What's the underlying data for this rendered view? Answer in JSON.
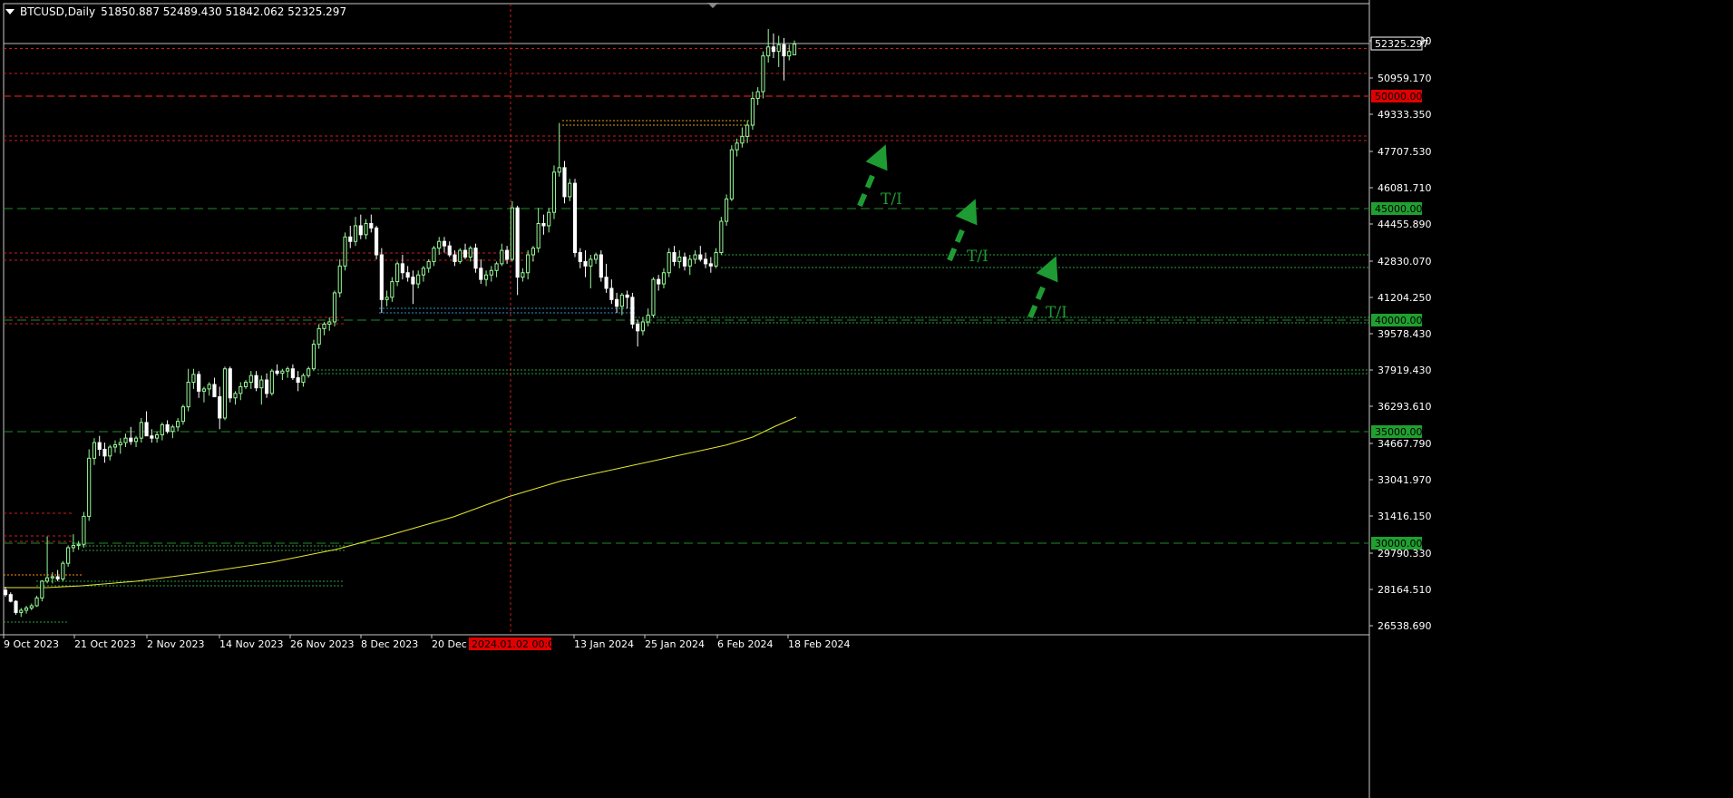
{
  "header": {
    "symbol": "BTCUSD,Daily",
    "ohlc": "51850.887 52489.430 51842.062 52325.297"
  },
  "colors": {
    "background": "#000000",
    "grid_border": "#c8c8c8",
    "candle_bull": "#98fb98",
    "candle_bear": "#ffffff",
    "red_line": "#c81e1e",
    "green_line": "#1e8c2d",
    "ma_line": "#e6e632",
    "arrow": "#1e9b32"
  },
  "price_axis": {
    "ticks": [
      "52584.090",
      "50959.170",
      "49333.350",
      "47707.530",
      "46081.710",
      "44455.890",
      "42830.070",
      "41204.250",
      "39578.430",
      "37919.430",
      "36293.610",
      "34667.790",
      "33041.970",
      "31416.150",
      "29790.330",
      "28164.510",
      "26538.690"
    ],
    "current_label": "52325.297",
    "badge_red": "50000.000",
    "badge_green_1": "45000.000",
    "badge_green_2": "40000.000",
    "badge_green_3": "35000.000",
    "badge_green_4": "30000.000"
  },
  "time_axis": {
    "ticks": [
      "9 Oct 2023",
      "21 Oct 2023",
      "2 Nov 2023",
      "14 Nov 2023",
      "26 Nov 2023",
      "8 Dec 2023",
      "20 Dec 2",
      "13 Jan 2024",
      "25 Jan 2024",
      "6 Feb 2024",
      "18 Feb 2024"
    ],
    "crosshair_label": "2024.01.02 00:00"
  },
  "annotations": {
    "ti_1": "T/I",
    "ti_2": "T/I",
    "ti_3": "T/I"
  },
  "chart_data": {
    "type": "candlestick",
    "symbol": "BTCUSD",
    "timeframe": "Daily",
    "ylim": [
      26000,
      54000
    ],
    "levels_red": [
      52325,
      51100,
      50000,
      48150,
      42900,
      40050
    ],
    "levels_green": [
      45000,
      40000,
      35000,
      30000
    ],
    "candles": [
      [
        27900,
        28050,
        27600,
        27700
      ],
      [
        27700,
        27800,
        27350,
        27400
      ],
      [
        27400,
        27450,
        26800,
        26900
      ],
      [
        26900,
        27100,
        26700,
        27000
      ],
      [
        27000,
        27200,
        26850,
        27100
      ],
      [
        27100,
        27300,
        27000,
        27200
      ],
      [
        27200,
        27650,
        27150,
        27550
      ],
      [
        27550,
        28350,
        27400,
        28300
      ],
      [
        28300,
        30300,
        28200,
        28450
      ],
      [
        28450,
        28700,
        28200,
        28500
      ],
      [
        28500,
        28800,
        28300,
        28400
      ],
      [
        28400,
        29200,
        28300,
        29100
      ],
      [
        29100,
        29900,
        28950,
        29800
      ],
      [
        29800,
        30400,
        29600,
        29900
      ],
      [
        29900,
        30100,
        29700,
        29950
      ],
      [
        29950,
        31400,
        29800,
        31200
      ],
      [
        31200,
        34200,
        31000,
        33800
      ],
      [
        33800,
        34700,
        33500,
        34500
      ],
      [
        34500,
        34800,
        33900,
        34200
      ],
      [
        34200,
        34500,
        33600,
        33900
      ],
      [
        33900,
        34400,
        33700,
        34300
      ],
      [
        34300,
        34600,
        34050,
        34400
      ],
      [
        34400,
        34700,
        34000,
        34500
      ],
      [
        34500,
        34900,
        34300,
        34700
      ],
      [
        34700,
        35200,
        34400,
        34550
      ],
      [
        34550,
        34800,
        34300,
        34700
      ],
      [
        34700,
        35600,
        34500,
        35400
      ],
      [
        35400,
        35900,
        34900,
        34800
      ],
      [
        34800,
        35100,
        34500,
        34700
      ],
      [
        34700,
        35000,
        34500,
        34850
      ],
      [
        34850,
        35400,
        34600,
        35300
      ],
      [
        35300,
        35500,
        34900,
        35000
      ],
      [
        35000,
        35300,
        34700,
        35200
      ],
      [
        35200,
        35600,
        35000,
        35450
      ],
      [
        35450,
        36200,
        35300,
        36100
      ],
      [
        36100,
        37800,
        35900,
        37200
      ],
      [
        37200,
        37800,
        36900,
        37550
      ],
      [
        37550,
        37700,
        36500,
        36800
      ],
      [
        36800,
        37000,
        36300,
        36900
      ],
      [
        36900,
        37200,
        36600,
        37100
      ],
      [
        37100,
        37400,
        36800,
        36550
      ],
      [
        36550,
        37000,
        35100,
        35600
      ],
      [
        35600,
        37900,
        35500,
        37800
      ],
      [
        37800,
        37900,
        36300,
        36500
      ],
      [
        36500,
        36800,
        36200,
        36700
      ],
      [
        36700,
        37200,
        36400,
        37000
      ],
      [
        37000,
        37300,
        36900,
        37200
      ],
      [
        37200,
        37700,
        36900,
        37500
      ],
      [
        37500,
        37700,
        36800,
        36950
      ],
      [
        36950,
        37500,
        36200,
        37300
      ],
      [
        37300,
        37600,
        36500,
        36700
      ],
      [
        36700,
        37800,
        36600,
        37700
      ],
      [
        37700,
        38000,
        37500,
        37600
      ],
      [
        37600,
        37800,
        37300,
        37700
      ],
      [
        37700,
        37900,
        37400,
        37800
      ],
      [
        37800,
        38000,
        37300,
        37400
      ],
      [
        37400,
        37700,
        36800,
        37200
      ],
      [
        37200,
        37600,
        37000,
        37500
      ],
      [
        37500,
        37900,
        37400,
        37800
      ],
      [
        37800,
        39100,
        37700,
        38900
      ],
      [
        38900,
        39800,
        38700,
        39600
      ],
      [
        39600,
        39900,
        39300,
        39800
      ],
      [
        39800,
        40100,
        39500,
        39900
      ],
      [
        39900,
        41300,
        39700,
        41200
      ],
      [
        41200,
        42700,
        41000,
        42400
      ],
      [
        42400,
        43900,
        42200,
        43700
      ],
      [
        43700,
        44200,
        43200,
        43500
      ],
      [
        43500,
        44600,
        43300,
        44200
      ],
      [
        44200,
        44700,
        43600,
        43800
      ],
      [
        43800,
        44500,
        43600,
        44300
      ],
      [
        44300,
        44700,
        43900,
        44100
      ],
      [
        44100,
        44200,
        42700,
        42900
      ],
      [
        42900,
        43200,
        40300,
        40900
      ],
      [
        40900,
        41300,
        40600,
        41000
      ],
      [
        41000,
        41900,
        40800,
        41700
      ],
      [
        41700,
        42600,
        41500,
        42500
      ],
      [
        42500,
        42900,
        41800,
        42100
      ],
      [
        42100,
        42400,
        41700,
        41900
      ],
      [
        41900,
        42200,
        40700,
        41600
      ],
      [
        41600,
        42200,
        41400,
        42000
      ],
      [
        42000,
        42400,
        41700,
        42300
      ],
      [
        42300,
        42700,
        42100,
        42600
      ],
      [
        42600,
        43300,
        42400,
        43200
      ],
      [
        43200,
        43700,
        42900,
        43500
      ],
      [
        43500,
        43700,
        43000,
        43300
      ],
      [
        43300,
        43500,
        42800,
        42900
      ],
      [
        42900,
        43100,
        42400,
        42600
      ],
      [
        42600,
        43200,
        42500,
        43100
      ],
      [
        43100,
        43400,
        42700,
        42800
      ],
      [
        42800,
        43300,
        42600,
        43200
      ],
      [
        43200,
        43400,
        42100,
        42300
      ],
      [
        42300,
        42700,
        41600,
        41800
      ],
      [
        41800,
        42200,
        41500,
        42000
      ],
      [
        42000,
        42400,
        41700,
        42200
      ],
      [
        42200,
        42600,
        41900,
        42500
      ],
      [
        42500,
        43400,
        42400,
        43100
      ],
      [
        43100,
        43300,
        42500,
        42700
      ],
      [
        42700,
        45300,
        42600,
        45000
      ],
      [
        45000,
        45100,
        41100,
        41900
      ],
      [
        41900,
        42300,
        41700,
        42100
      ],
      [
        42100,
        43100,
        41800,
        42900
      ],
      [
        42900,
        43300,
        42600,
        43200
      ],
      [
        43200,
        45000,
        43000,
        44300
      ],
      [
        44300,
        44700,
        43800,
        44200
      ],
      [
        44200,
        45000,
        43900,
        44800
      ],
      [
        44800,
        46900,
        44500,
        46600
      ],
      [
        46600,
        48800,
        46400,
        46800
      ],
      [
        46800,
        47100,
        45200,
        45500
      ],
      [
        45500,
        46300,
        45300,
        46100
      ],
      [
        46100,
        46300,
        42800,
        43000
      ],
      [
        43000,
        43200,
        42300,
        42600
      ],
      [
        42600,
        43100,
        41900,
        42400
      ],
      [
        42400,
        42900,
        41400,
        42700
      ],
      [
        42700,
        43000,
        42500,
        42900
      ],
      [
        42900,
        43100,
        41700,
        41900
      ],
      [
        41900,
        42500,
        41200,
        41400
      ],
      [
        41400,
        41800,
        40700,
        40900
      ],
      [
        40900,
        41200,
        40300,
        40600
      ],
      [
        40600,
        41200,
        40200,
        41100
      ],
      [
        41100,
        41300,
        40500,
        41000
      ],
      [
        41000,
        41200,
        39600,
        39800
      ],
      [
        39800,
        40000,
        38800,
        39500
      ],
      [
        39500,
        40100,
        39300,
        39900
      ],
      [
        39900,
        40500,
        39700,
        40200
      ],
      [
        40200,
        41900,
        40100,
        41800
      ],
      [
        41800,
        42000,
        41300,
        41600
      ],
      [
        41600,
        42300,
        41400,
        42100
      ],
      [
        42100,
        43200,
        41900,
        43000
      ],
      [
        43000,
        43300,
        42400,
        42600
      ],
      [
        42600,
        43100,
        42300,
        42800
      ],
      [
        42800,
        43000,
        42200,
        42400
      ],
      [
        42400,
        42900,
        42000,
        42700
      ],
      [
        42700,
        43100,
        42500,
        42900
      ],
      [
        42900,
        43300,
        42600,
        42700
      ],
      [
        42700,
        43000,
        42300,
        42500
      ],
      [
        42500,
        42800,
        42100,
        42400
      ],
      [
        42400,
        43200,
        42300,
        43000
      ],
      [
        43000,
        44600,
        42900,
        44400
      ],
      [
        44400,
        45600,
        44200,
        45400
      ],
      [
        45400,
        47800,
        45300,
        47600
      ],
      [
        47600,
        48100,
        47300,
        47900
      ],
      [
        47900,
        48600,
        47700,
        48200
      ],
      [
        48200,
        48900,
        47900,
        48700
      ],
      [
        48700,
        50200,
        48500,
        49900
      ],
      [
        49900,
        50400,
        49600,
        50200
      ],
      [
        50200,
        52000,
        49900,
        51800
      ],
      [
        51800,
        53000,
        51500,
        52200
      ],
      [
        52200,
        52800,
        51700,
        52000
      ],
      [
        52000,
        52700,
        51300,
        52300
      ],
      [
        52300,
        52600,
        50700,
        51800
      ],
      [
        51800,
        52300,
        51600,
        52000
      ],
      [
        51850,
        52489,
        51842,
        52325
      ]
    ]
  }
}
